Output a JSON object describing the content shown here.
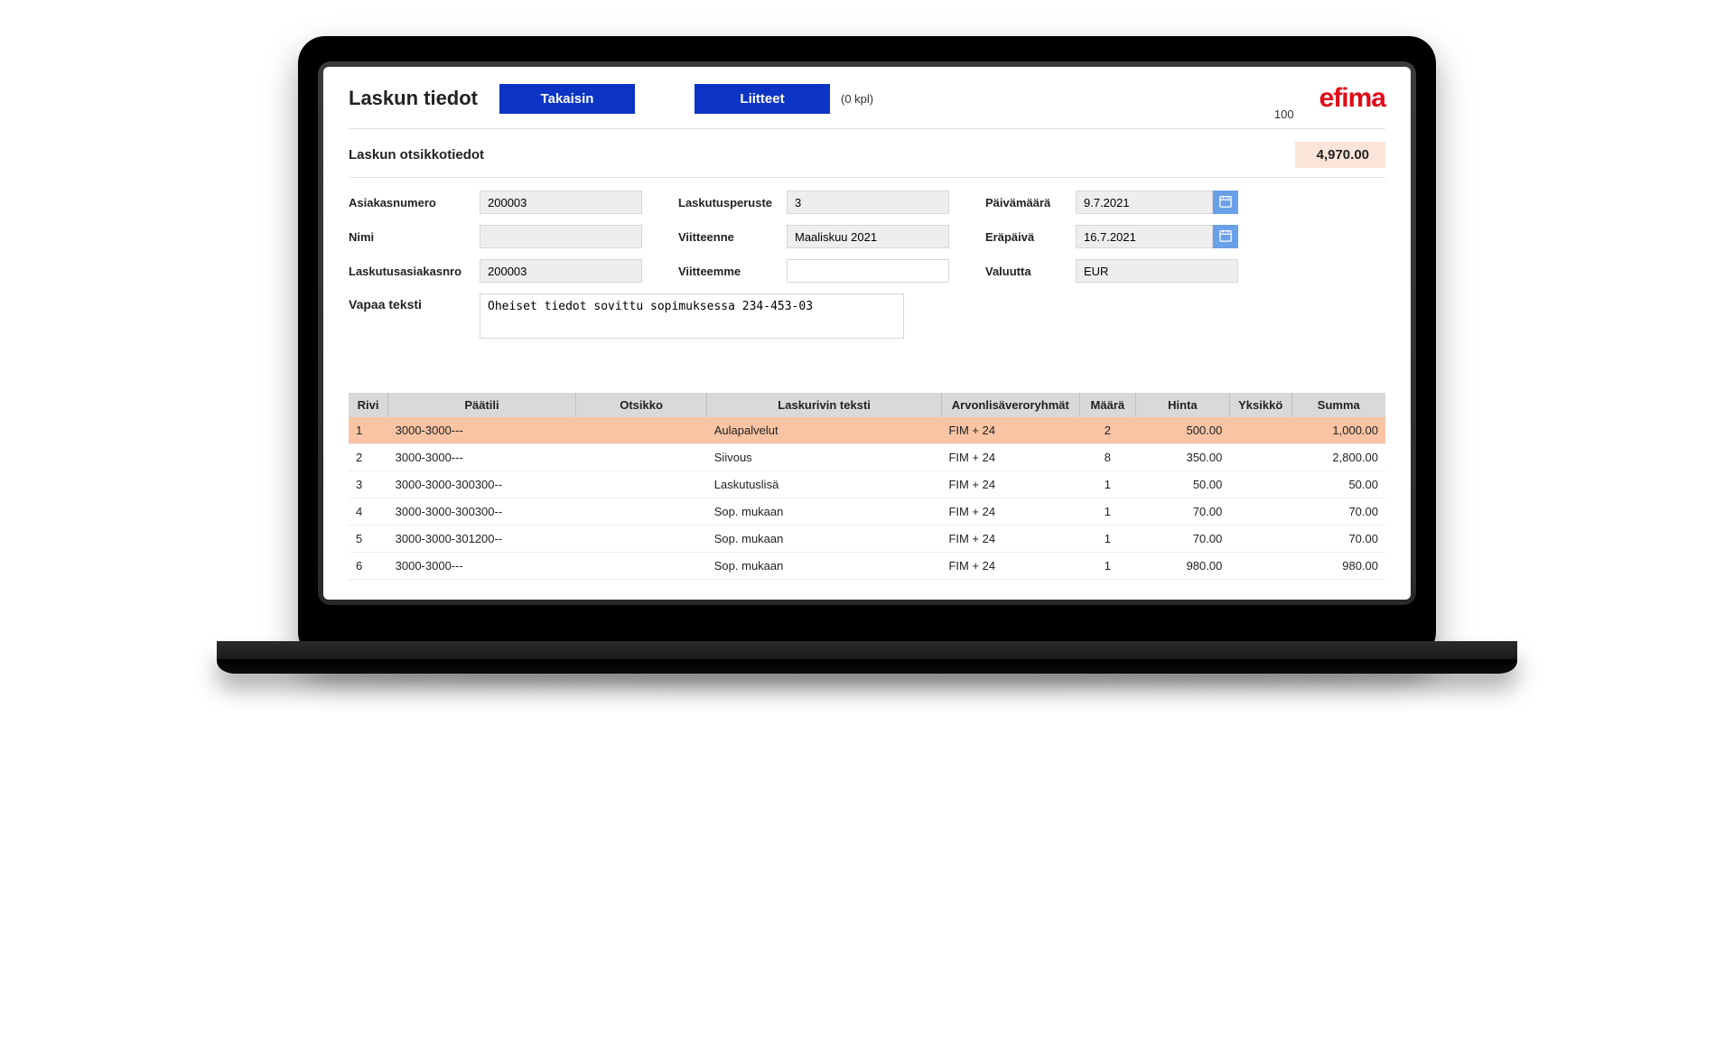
{
  "header": {
    "title": "Laskun tiedot",
    "back_label": "Takaisin",
    "attachments_label": "Liitteet",
    "attachments_count": "(0 kpl)",
    "number_indicator": "100",
    "logo_text": "efima"
  },
  "section": {
    "title": "Laskun otsikkotiedot",
    "total": "4,970.00"
  },
  "form": {
    "labels": {
      "customer_no": "Asiakasnumero",
      "name": "Nimi",
      "billing_customer_no": "Laskutusasiakasnro",
      "free_text": "Vapaa teksti",
      "billing_basis": "Laskutusperuste",
      "your_ref": "Viitteenne",
      "our_ref": "Viitteemme",
      "date": "Päivämäärä",
      "due_date": "Eräpäivä",
      "currency": "Valuutta"
    },
    "values": {
      "customer_no": "200003",
      "name": "",
      "billing_customer_no": "200003",
      "free_text": "Oheiset tiedot sovittu sopimuksessa 234-453-03",
      "billing_basis": "3",
      "your_ref": "Maaliskuu 2021",
      "our_ref": "",
      "date": "9.7.2021",
      "due_date": "16.7.2021",
      "currency": "EUR"
    }
  },
  "table": {
    "headers": {
      "row": "Rivi",
      "main_account": "Päätili",
      "title": "Otsikko",
      "line_text": "Laskurivin teksti",
      "vat_groups": "Arvonlisäveroryhmät",
      "qty": "Määrä",
      "price": "Hinta",
      "unit": "Yksikkö",
      "sum": "Summa"
    },
    "rows": [
      {
        "rivi": "1",
        "paatili": "3000-3000---",
        "otsikko": "",
        "teksti": "Aulapalvelut",
        "alv": "FIM + 24",
        "maara": "2",
        "hinta": "500.00",
        "yksikko": "",
        "summa": "1,000.00",
        "selected": true
      },
      {
        "rivi": "2",
        "paatili": "3000-3000---",
        "otsikko": "",
        "teksti": "Siivous",
        "alv": "FIM + 24",
        "maara": "8",
        "hinta": "350.00",
        "yksikko": "",
        "summa": "2,800.00",
        "selected": false
      },
      {
        "rivi": "3",
        "paatili": "3000-3000-300300--",
        "otsikko": "",
        "teksti": "Laskutuslisä",
        "alv": "FIM + 24",
        "maara": "1",
        "hinta": "50.00",
        "yksikko": "",
        "summa": "50.00",
        "selected": false
      },
      {
        "rivi": "4",
        "paatili": "3000-3000-300300--",
        "otsikko": "",
        "teksti": "Sop. mukaan",
        "alv": "FIM + 24",
        "maara": "1",
        "hinta": "70.00",
        "yksikko": "",
        "summa": "70.00",
        "selected": false
      },
      {
        "rivi": "5",
        "paatili": "3000-3000-301200--",
        "otsikko": "",
        "teksti": "Sop. mukaan",
        "alv": "FIM + 24",
        "maara": "1",
        "hinta": "70.00",
        "yksikko": "",
        "summa": "70.00",
        "selected": false
      },
      {
        "rivi": "6",
        "paatili": "3000-3000---",
        "otsikko": "",
        "teksti": "Sop. mukaan",
        "alv": "FIM + 24",
        "maara": "1",
        "hinta": "980.00",
        "yksikko": "",
        "summa": "980.00",
        "selected": false
      }
    ]
  }
}
